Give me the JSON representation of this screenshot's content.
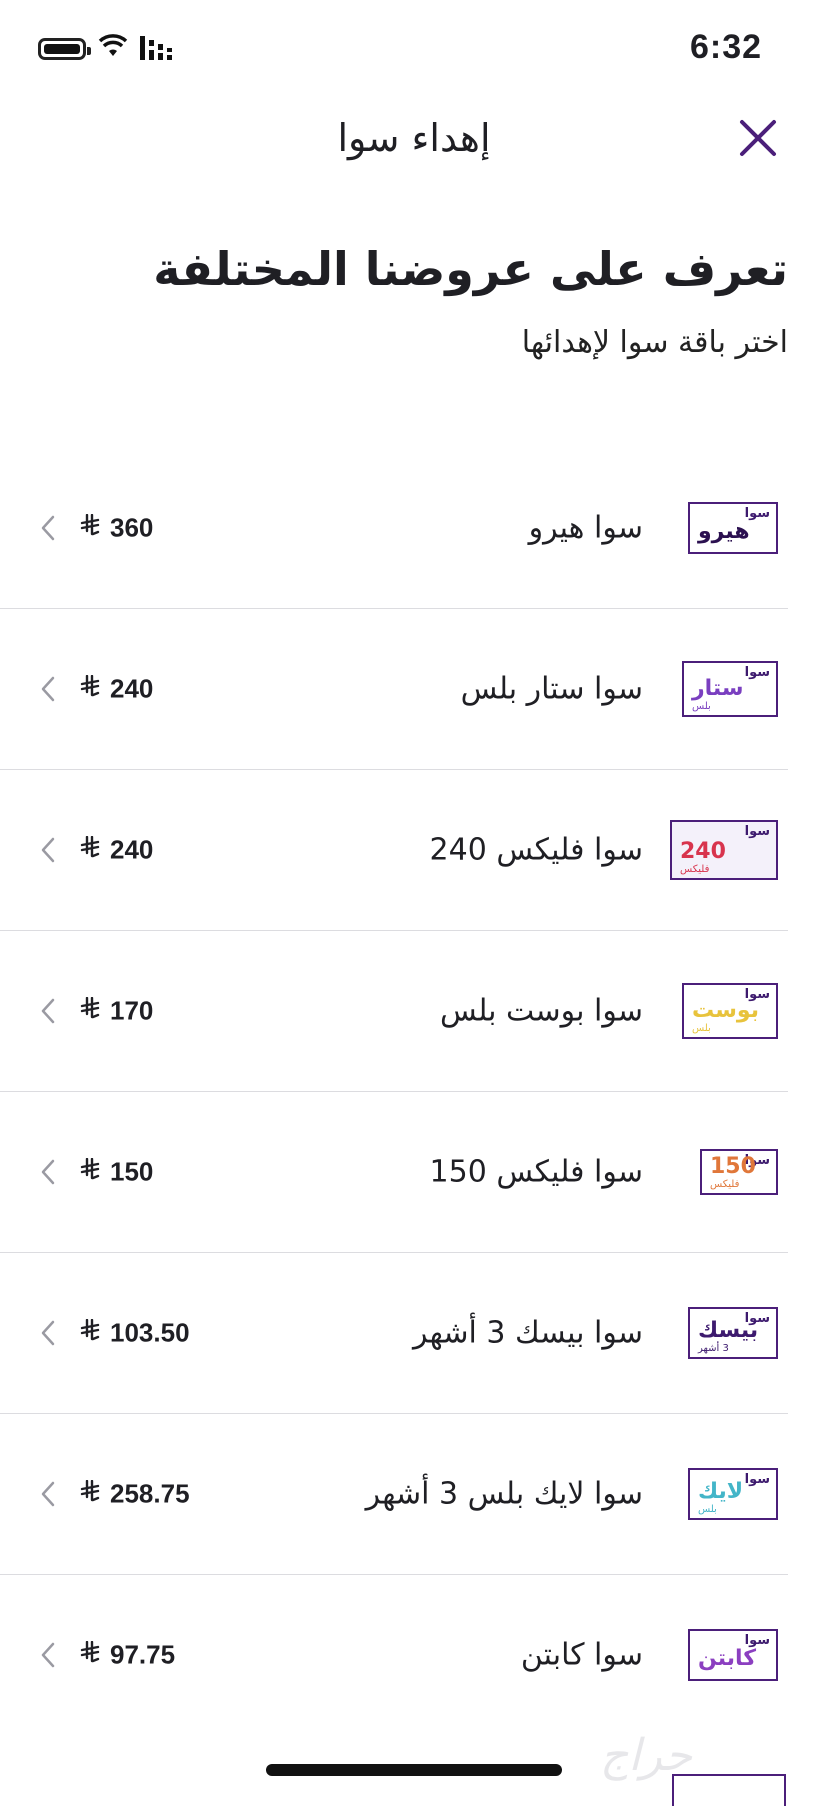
{
  "status_bar": {
    "time": "6:32"
  },
  "header": {
    "title": "إهداء سوا",
    "close_icon": "close-icon"
  },
  "intro": {
    "heading": "تعرف على عروضنا المختلفة",
    "subheading": "اختر باقة سوا لإهدائها"
  },
  "currency_symbol": "⃁",
  "packages": [
    {
      "name": "سوا هيرو",
      "price": "360",
      "logo": {
        "sawa": "سوا",
        "main": "هيرو",
        "sub": "",
        "color": "#2b1050"
      }
    },
    {
      "name": "سوا ستار بلس",
      "price": "240",
      "logo": {
        "sawa": "سوا",
        "main": "ستار",
        "sub": "بلس",
        "color": "#7a3fc0"
      }
    },
    {
      "name": "سوا فليكس 240",
      "price": "240",
      "logo": {
        "sawa": "سوا",
        "main": "240",
        "sub": "فليكس",
        "color": "#d8344d"
      }
    },
    {
      "name": "سوا بوست بلس",
      "price": "170",
      "logo": {
        "sawa": "سوا",
        "main": "بوست",
        "sub": "بلس",
        "color": "#e8c33c"
      }
    },
    {
      "name": "سوا فليكس 150",
      "price": "150",
      "logo": {
        "sawa": "سوا",
        "main": "150",
        "sub": "فليكس",
        "color": "#e0773a"
      }
    },
    {
      "name": "سوا بيسك 3 أشهر",
      "price": "103.50",
      "logo": {
        "sawa": "سوا",
        "main": "بيسك",
        "sub": "3 أشهر",
        "color": "#3d1a6e"
      }
    },
    {
      "name": "سوا لايك بلس 3 أشهر",
      "price": "258.75",
      "logo": {
        "sawa": "سوا",
        "main": "لايك",
        "sub": "بلس",
        "color": "#43b5c8"
      }
    },
    {
      "name": "سوا كابتن",
      "price": "97.75",
      "logo": {
        "sawa": "سوا",
        "main": "كابتن",
        "sub": "",
        "color": "#8b3fc0"
      }
    }
  ],
  "watermark": "حراج",
  "colors": {
    "accent": "#4b1f7a",
    "text": "#1f1f24",
    "divider": "#dcdce0"
  }
}
